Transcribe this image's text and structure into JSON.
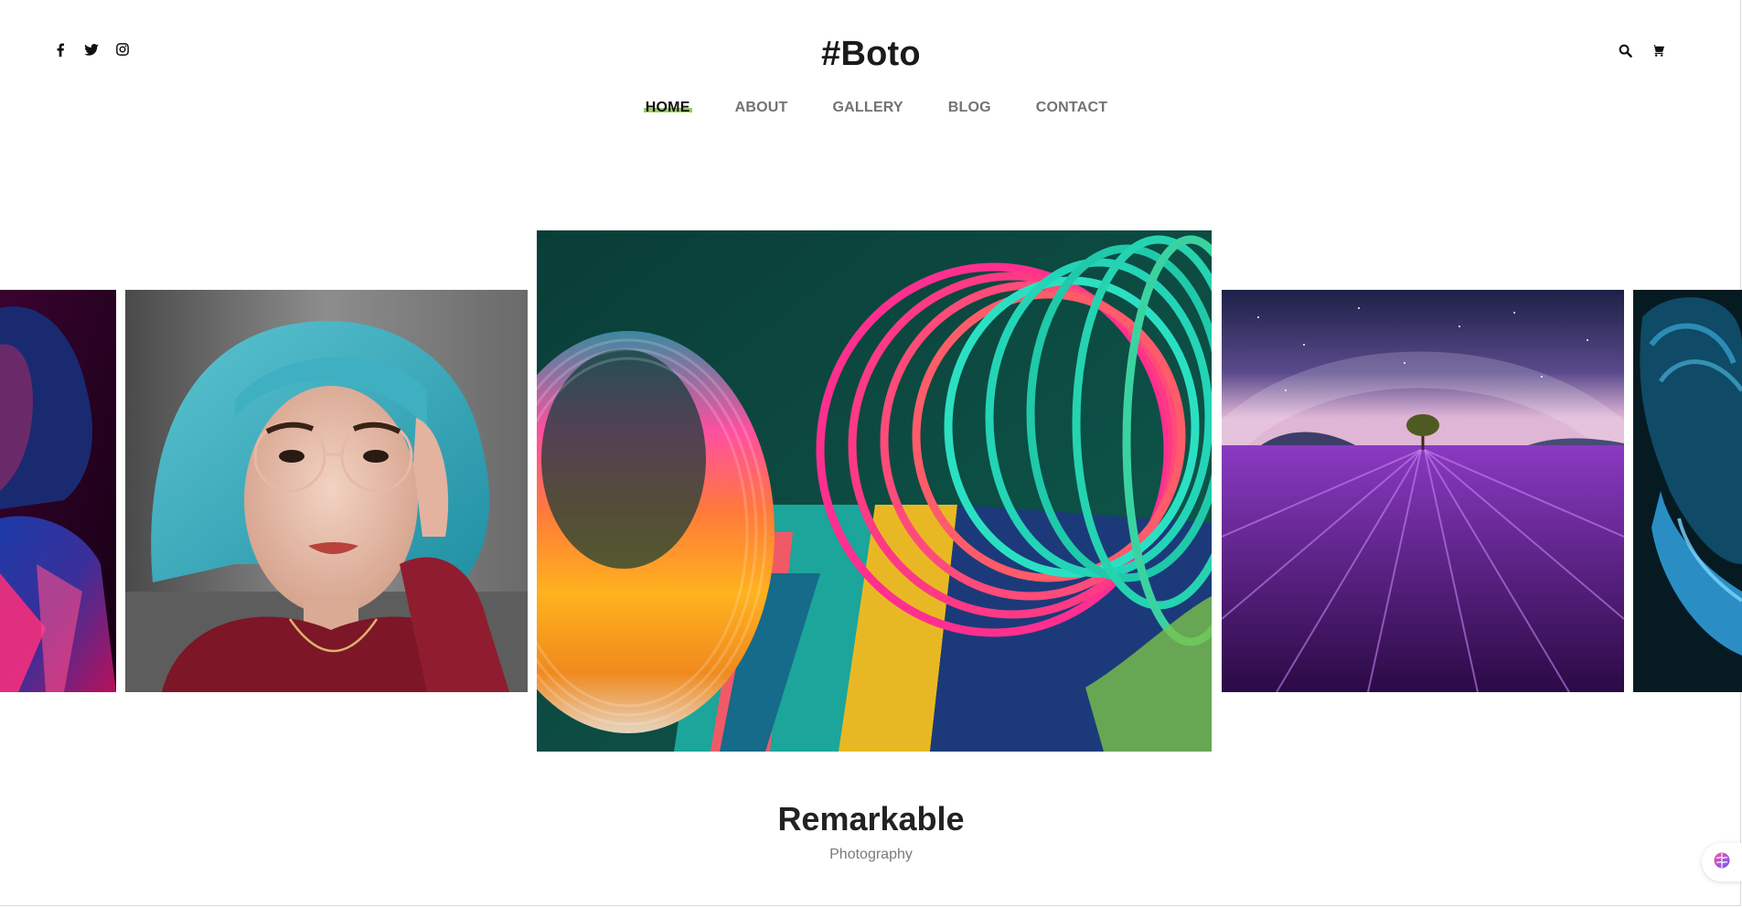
{
  "header": {
    "brand": "#Boto",
    "social_icons": [
      "facebook-icon",
      "twitter-icon",
      "instagram-icon"
    ],
    "tool_icons": [
      "search-icon",
      "cart-icon"
    ]
  },
  "nav": {
    "items": [
      {
        "label": "HOME",
        "active": true
      },
      {
        "label": "ABOUT",
        "active": false
      },
      {
        "label": "GALLERY",
        "active": false
      },
      {
        "label": "BLOG",
        "active": false
      },
      {
        "label": "CONTACT",
        "active": false
      }
    ]
  },
  "gallery": {
    "active_slide": {
      "title": "Remarkable",
      "category": "Photography"
    },
    "slides": [
      "neon-portrait",
      "teal-hair-portrait",
      "rainbow-slinky",
      "lavender-field-night",
      "blue-portrait"
    ]
  },
  "colors": {
    "nav_active_highlight": "#8bc34a",
    "nav_text": "#727272",
    "brand_text": "#1a1a1a"
  },
  "widget": {
    "icon": "assistant-brain-icon"
  }
}
